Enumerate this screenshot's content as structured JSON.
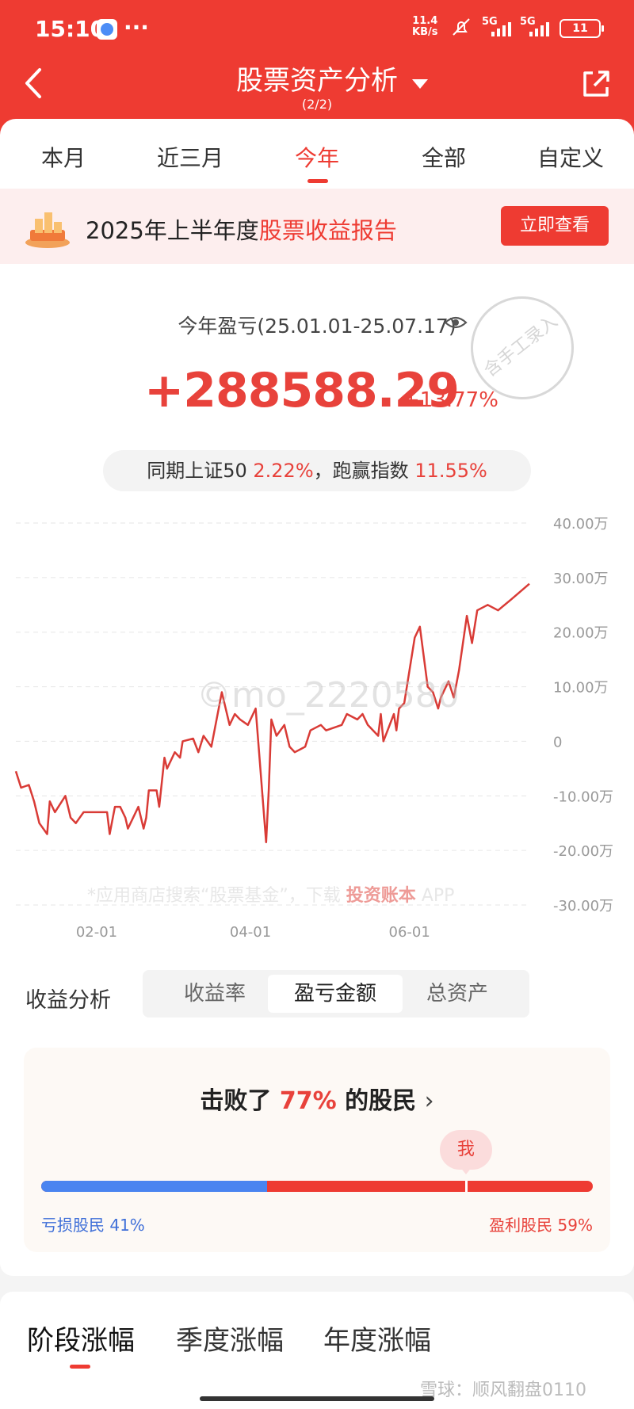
{
  "status_bar": {
    "time": "15:10",
    "more": "···",
    "speed_value": "11.4",
    "speed_unit": "KB/s",
    "signal1": "5G",
    "signal2": "5G",
    "battery": "11"
  },
  "nav": {
    "title": "股票资产分析",
    "page": "(2/2)"
  },
  "tabs": [
    "本月",
    "近三月",
    "今年",
    "全部",
    "自定义"
  ],
  "active_tab": "今年",
  "promo": {
    "text_plain": "2025年上半年度",
    "text_highlight": "股票收益报告",
    "button": "立即查看"
  },
  "summary": {
    "label": "今年盈亏(25.01.01-25.07.17)",
    "amount": "+288588.29",
    "percent": "+13.77%",
    "compare_prefix": "同期上证50",
    "compare_index_pct": "2.22%",
    "compare_mid": "，跑赢指数",
    "compare_beat_pct": "11.55%",
    "stamp": "含手工录入"
  },
  "watermark": "©mo_2220580",
  "chart_watermark": {
    "text": "*应用商店搜索“股票基金”，下载",
    "brand": "投资账本",
    "suffix": "APP"
  },
  "chart_data": {
    "type": "line",
    "title": "",
    "xlabel": "",
    "ylabel": "",
    "x_tick_labels": [
      "02-01",
      "04-01",
      "06-01"
    ],
    "y_tick_labels": [
      "40.00万",
      "30.00万",
      "20.00万",
      "10.00万",
      "0",
      "-10.00万",
      "-20.00万",
      "-30.00万"
    ],
    "ylim": [
      -300000,
      400000
    ],
    "xlim": [
      "2025-01-01",
      "2025-07-17"
    ],
    "grid": true,
    "series": [
      {
        "color": "#d93b36",
        "points": [
          [
            "2025-01-01",
            -55000
          ],
          [
            "2025-01-03",
            -85000
          ],
          [
            "2025-01-06",
            -80000
          ],
          [
            "2025-01-08",
            -110000
          ],
          [
            "2025-01-10",
            -150000
          ],
          [
            "2025-01-13",
            -170000
          ],
          [
            "2025-01-14",
            -110000
          ],
          [
            "2025-01-16",
            -130000
          ],
          [
            "2025-01-20",
            -100000
          ],
          [
            "2025-01-22",
            -140000
          ],
          [
            "2025-01-24",
            -150000
          ],
          [
            "2025-01-27",
            -130000
          ],
          [
            "2025-02-05",
            -130000
          ],
          [
            "2025-02-06",
            -170000
          ],
          [
            "2025-02-08",
            -120000
          ],
          [
            "2025-02-10",
            -120000
          ],
          [
            "2025-02-12",
            -140000
          ],
          [
            "2025-02-13",
            -160000
          ],
          [
            "2025-02-17",
            -120000
          ],
          [
            "2025-02-19",
            -160000
          ],
          [
            "2025-02-20",
            -140000
          ],
          [
            "2025-02-21",
            -90000
          ],
          [
            "2025-02-24",
            -90000
          ],
          [
            "2025-02-25",
            -120000
          ],
          [
            "2025-02-27",
            -30000
          ],
          [
            "2025-02-28",
            -50000
          ],
          [
            "2025-03-03",
            -20000
          ],
          [
            "2025-03-05",
            -30000
          ],
          [
            "2025-03-06",
            0
          ],
          [
            "2025-03-10",
            5000
          ],
          [
            "2025-03-12",
            -20000
          ],
          [
            "2025-03-14",
            10000
          ],
          [
            "2025-03-17",
            -10000
          ],
          [
            "2025-03-19",
            40000
          ],
          [
            "2025-03-21",
            90000
          ],
          [
            "2025-03-24",
            30000
          ],
          [
            "2025-03-26",
            50000
          ],
          [
            "2025-03-28",
            40000
          ],
          [
            "2025-03-31",
            30000
          ],
          [
            "2025-04-03",
            60000
          ],
          [
            "2025-04-07",
            -185000
          ],
          [
            "2025-04-08",
            -90000
          ],
          [
            "2025-04-09",
            40000
          ],
          [
            "2025-04-11",
            10000
          ],
          [
            "2025-04-14",
            30000
          ],
          [
            "2025-04-16",
            -10000
          ],
          [
            "2025-04-18",
            -20000
          ],
          [
            "2025-04-22",
            -10000
          ],
          [
            "2025-04-24",
            20000
          ],
          [
            "2025-04-28",
            30000
          ],
          [
            "2025-04-30",
            20000
          ],
          [
            "2025-05-06",
            30000
          ],
          [
            "2025-05-08",
            50000
          ],
          [
            "2025-05-12",
            40000
          ],
          [
            "2025-05-14",
            50000
          ],
          [
            "2025-05-16",
            30000
          ],
          [
            "2025-05-20",
            10000
          ],
          [
            "2025-05-21",
            50000
          ],
          [
            "2025-05-22",
            0
          ],
          [
            "2025-05-26",
            50000
          ],
          [
            "2025-05-27",
            20000
          ],
          [
            "2025-05-28",
            60000
          ],
          [
            "2025-05-30",
            70000
          ],
          [
            "2025-06-03",
            190000
          ],
          [
            "2025-06-05",
            210000
          ],
          [
            "2025-06-08",
            100000
          ],
          [
            "2025-06-10",
            90000
          ],
          [
            "2025-06-12",
            60000
          ],
          [
            "2025-06-13",
            80000
          ],
          [
            "2025-06-16",
            110000
          ],
          [
            "2025-06-18",
            80000
          ],
          [
            "2025-06-20",
            130000
          ],
          [
            "2025-06-23",
            230000
          ],
          [
            "2025-06-25",
            180000
          ],
          [
            "2025-06-27",
            240000
          ],
          [
            "2025-07-01",
            250000
          ],
          [
            "2025-07-05",
            240000
          ],
          [
            "2025-07-10",
            260000
          ],
          [
            "2025-07-17",
            288588.29
          ]
        ]
      }
    ]
  },
  "analysis": {
    "label": "收益分析",
    "segments": [
      "收益率",
      "盈亏金额",
      "总资产"
    ],
    "active_segment": "盈亏金额"
  },
  "beat": {
    "prefix": "击败了",
    "percent": "77%",
    "suffix": "的股民",
    "me_label": "我",
    "me_position": 0.77,
    "loss_share": 0.41,
    "loss_label": "亏损股民",
    "loss_pct": "41%",
    "win_label": "盈利股民",
    "win_pct": "59%"
  },
  "bottom_tabs": [
    "阶段涨幅",
    "季度涨幅",
    "年度涨幅"
  ],
  "footer_watermark": "雪球：顺风翻盘0110"
}
